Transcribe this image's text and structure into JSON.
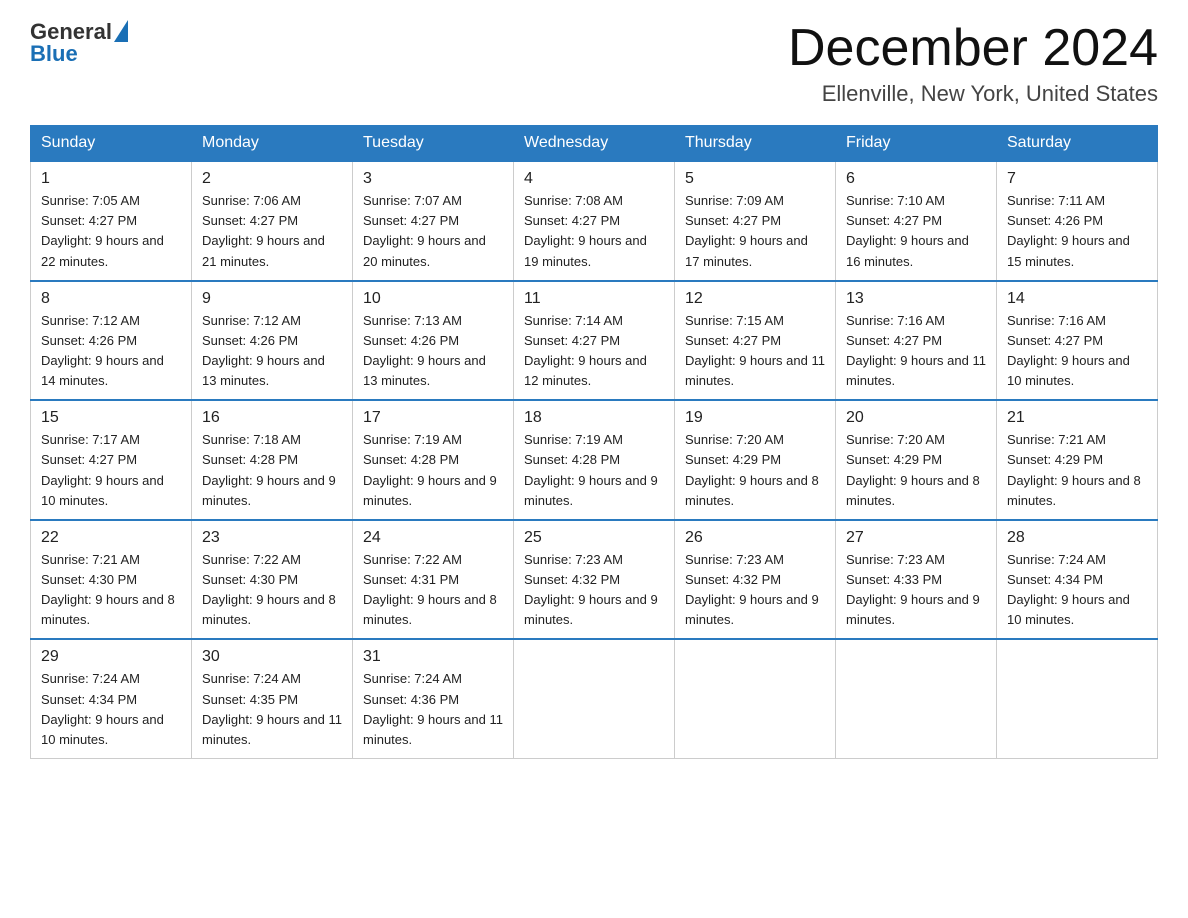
{
  "header": {
    "logo_line1": "General",
    "logo_line2": "Blue",
    "month_title": "December 2024",
    "location": "Ellenville, New York, United States"
  },
  "days_of_week": [
    "Sunday",
    "Monday",
    "Tuesday",
    "Wednesday",
    "Thursday",
    "Friday",
    "Saturday"
  ],
  "weeks": [
    [
      {
        "num": "1",
        "sunrise": "7:05 AM",
        "sunset": "4:27 PM",
        "daylight": "9 hours and 22 minutes."
      },
      {
        "num": "2",
        "sunrise": "7:06 AM",
        "sunset": "4:27 PM",
        "daylight": "9 hours and 21 minutes."
      },
      {
        "num": "3",
        "sunrise": "7:07 AM",
        "sunset": "4:27 PM",
        "daylight": "9 hours and 20 minutes."
      },
      {
        "num": "4",
        "sunrise": "7:08 AM",
        "sunset": "4:27 PM",
        "daylight": "9 hours and 19 minutes."
      },
      {
        "num": "5",
        "sunrise": "7:09 AM",
        "sunset": "4:27 PM",
        "daylight": "9 hours and 17 minutes."
      },
      {
        "num": "6",
        "sunrise": "7:10 AM",
        "sunset": "4:27 PM",
        "daylight": "9 hours and 16 minutes."
      },
      {
        "num": "7",
        "sunrise": "7:11 AM",
        "sunset": "4:26 PM",
        "daylight": "9 hours and 15 minutes."
      }
    ],
    [
      {
        "num": "8",
        "sunrise": "7:12 AM",
        "sunset": "4:26 PM",
        "daylight": "9 hours and 14 minutes."
      },
      {
        "num": "9",
        "sunrise": "7:12 AM",
        "sunset": "4:26 PM",
        "daylight": "9 hours and 13 minutes."
      },
      {
        "num": "10",
        "sunrise": "7:13 AM",
        "sunset": "4:26 PM",
        "daylight": "9 hours and 13 minutes."
      },
      {
        "num": "11",
        "sunrise": "7:14 AM",
        "sunset": "4:27 PM",
        "daylight": "9 hours and 12 minutes."
      },
      {
        "num": "12",
        "sunrise": "7:15 AM",
        "sunset": "4:27 PM",
        "daylight": "9 hours and 11 minutes."
      },
      {
        "num": "13",
        "sunrise": "7:16 AM",
        "sunset": "4:27 PM",
        "daylight": "9 hours and 11 minutes."
      },
      {
        "num": "14",
        "sunrise": "7:16 AM",
        "sunset": "4:27 PM",
        "daylight": "9 hours and 10 minutes."
      }
    ],
    [
      {
        "num": "15",
        "sunrise": "7:17 AM",
        "sunset": "4:27 PM",
        "daylight": "9 hours and 10 minutes."
      },
      {
        "num": "16",
        "sunrise": "7:18 AM",
        "sunset": "4:28 PM",
        "daylight": "9 hours and 9 minutes."
      },
      {
        "num": "17",
        "sunrise": "7:19 AM",
        "sunset": "4:28 PM",
        "daylight": "9 hours and 9 minutes."
      },
      {
        "num": "18",
        "sunrise": "7:19 AM",
        "sunset": "4:28 PM",
        "daylight": "9 hours and 9 minutes."
      },
      {
        "num": "19",
        "sunrise": "7:20 AM",
        "sunset": "4:29 PM",
        "daylight": "9 hours and 8 minutes."
      },
      {
        "num": "20",
        "sunrise": "7:20 AM",
        "sunset": "4:29 PM",
        "daylight": "9 hours and 8 minutes."
      },
      {
        "num": "21",
        "sunrise": "7:21 AM",
        "sunset": "4:29 PM",
        "daylight": "9 hours and 8 minutes."
      }
    ],
    [
      {
        "num": "22",
        "sunrise": "7:21 AM",
        "sunset": "4:30 PM",
        "daylight": "9 hours and 8 minutes."
      },
      {
        "num": "23",
        "sunrise": "7:22 AM",
        "sunset": "4:30 PM",
        "daylight": "9 hours and 8 minutes."
      },
      {
        "num": "24",
        "sunrise": "7:22 AM",
        "sunset": "4:31 PM",
        "daylight": "9 hours and 8 minutes."
      },
      {
        "num": "25",
        "sunrise": "7:23 AM",
        "sunset": "4:32 PM",
        "daylight": "9 hours and 9 minutes."
      },
      {
        "num": "26",
        "sunrise": "7:23 AM",
        "sunset": "4:32 PM",
        "daylight": "9 hours and 9 minutes."
      },
      {
        "num": "27",
        "sunrise": "7:23 AM",
        "sunset": "4:33 PM",
        "daylight": "9 hours and 9 minutes."
      },
      {
        "num": "28",
        "sunrise": "7:24 AM",
        "sunset": "4:34 PM",
        "daylight": "9 hours and 10 minutes."
      }
    ],
    [
      {
        "num": "29",
        "sunrise": "7:24 AM",
        "sunset": "4:34 PM",
        "daylight": "9 hours and 10 minutes."
      },
      {
        "num": "30",
        "sunrise": "7:24 AM",
        "sunset": "4:35 PM",
        "daylight": "9 hours and 11 minutes."
      },
      {
        "num": "31",
        "sunrise": "7:24 AM",
        "sunset": "4:36 PM",
        "daylight": "9 hours and 11 minutes."
      },
      null,
      null,
      null,
      null
    ]
  ]
}
